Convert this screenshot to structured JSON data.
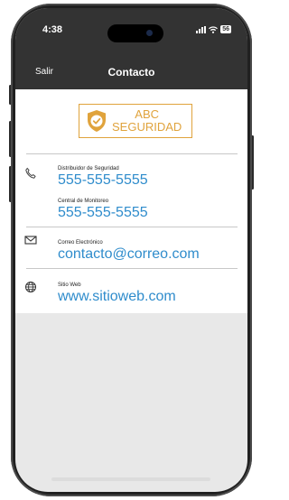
{
  "status_bar": {
    "time": "4:38",
    "battery": "56"
  },
  "nav": {
    "back_label": "Salir",
    "title": "Contacto"
  },
  "logo": {
    "line1": "ABC",
    "line2": "SEGURIDAD",
    "color": "#e0a33c"
  },
  "contacts": {
    "phone1_label": "Distribuidor de Seguridad",
    "phone1_value": "555-555-5555",
    "phone2_label": "Central de Monitoreo",
    "phone2_value": "555-555-5555",
    "email_label": "Correo Electrónico",
    "email_value": "contacto@correo.com",
    "web_label": "Sitio Web",
    "web_value": "www.sitioweb.com"
  },
  "colors": {
    "nav_bg": "#333333",
    "link": "#2f8ccc",
    "accent": "#e0a33c"
  },
  "icons": [
    "phone-icon",
    "mail-icon",
    "globe-icon"
  ]
}
